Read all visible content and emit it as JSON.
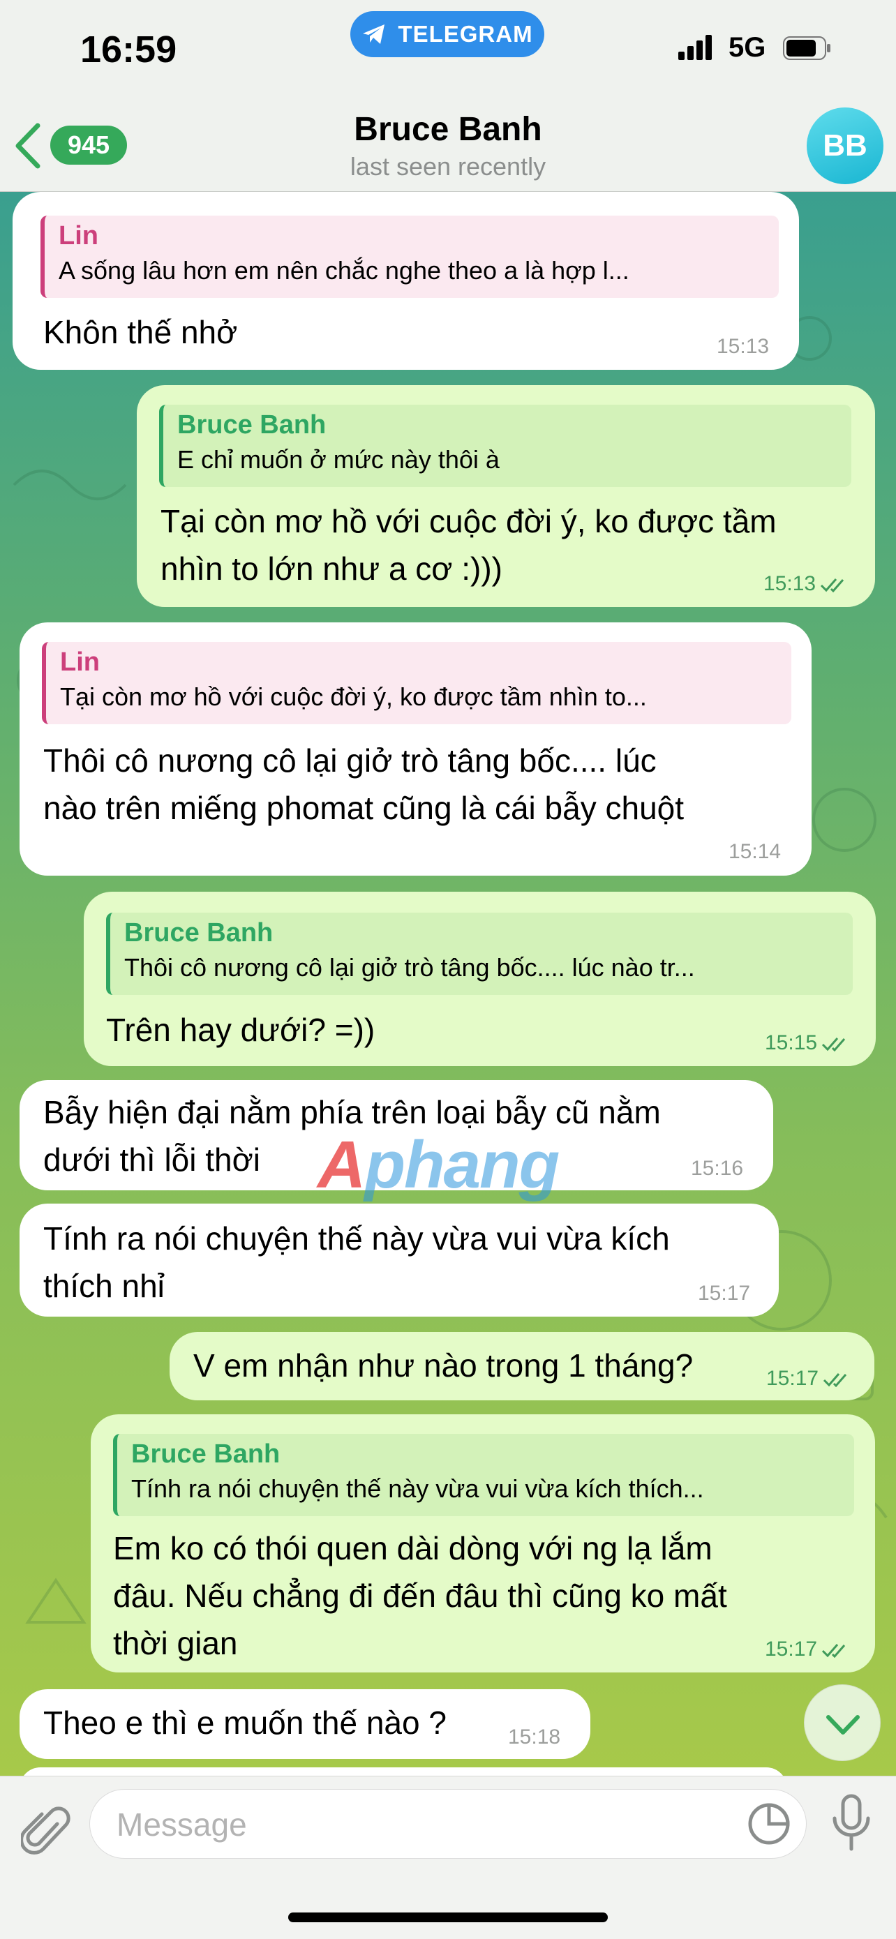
{
  "status": {
    "time": "16:59",
    "app_pill": "TELEGRAM",
    "network": "5G"
  },
  "header": {
    "unread_count": "945",
    "contact_name": "Bruce Banh",
    "last_seen": "last seen recently",
    "avatar_initials": "BB"
  },
  "messages": [
    {
      "dir": "in",
      "quote_name": "Lin",
      "quote_text": "A sống lâu hơn em nên chắc nghe theo a là hợp l...",
      "text": "Khôn thế nhở",
      "time": "15:13"
    },
    {
      "dir": "out",
      "quote_name": "Bruce Banh",
      "quote_text": "E chỉ muốn ở mức này thôi à",
      "text": "Tại còn mơ hồ với cuộc đời ý, ko được tầm\nnhìn to lớn như a cơ :)))",
      "time": "15:13"
    },
    {
      "dir": "in",
      "quote_name": "Lin",
      "quote_text": "Tại còn mơ hồ với cuộc đời ý, ko được tầm nhìn to...",
      "text": "Thôi cô nương cô lại giở trò tâng bốc.... lúc\nnào trên miếng phomat cũng là cái bẫy chuột",
      "time": "15:14"
    },
    {
      "dir": "out",
      "quote_name": "Bruce Banh",
      "quote_text": "Thôi cô nương cô lại giở trò tâng bốc.... lúc nào tr...",
      "text": "Trên hay dưới? =))",
      "time": "15:15"
    },
    {
      "dir": "in",
      "text": "Bẫy hiện đại nằm phía trên loại bẫy cũ nằm\ndưới thì lỗi thời",
      "time": "15:16"
    },
    {
      "dir": "in",
      "text": "Tính ra nói chuyện thế này vừa vui vừa kích\nthích nhỉ",
      "time": "15:17"
    },
    {
      "dir": "out",
      "text": "V em nhận như nào trong 1 tháng?",
      "time": "15:17"
    },
    {
      "dir": "out",
      "quote_name": "Bruce Banh",
      "quote_text": "Tính ra nói chuyện thế này vừa vui vừa kích thích...",
      "text": "Em ko có thói quen dài dòng với ng lạ lắm\nđâu. Nếu chẳng đi đến đâu thì cũng ko mất\nthời gian",
      "time": "15:17"
    },
    {
      "dir": "in",
      "text": "Theo e thì e muốn thế nào ?",
      "time": "15:18"
    }
  ],
  "watermark": {
    "a": "A",
    "rest": "phang"
  },
  "composer": {
    "placeholder": "Message"
  },
  "icons": {
    "back": "chevron-left-icon",
    "telegram": "paper-plane-icon",
    "signal": "signal-bars-icon",
    "battery": "battery-icon",
    "read": "double-check-icon",
    "scroll": "chevron-down-icon",
    "attach": "paperclip-icon",
    "sticker": "sticker-icon",
    "mic": "microphone-icon"
  },
  "colors": {
    "accent": "#2f8eea",
    "badge": "#35a95a",
    "incoming_bubble": "#ffffff",
    "outgoing_bubble": "#e4fbc8",
    "quote_in": "#cc3f7b",
    "quote_out": "#2ea662"
  }
}
